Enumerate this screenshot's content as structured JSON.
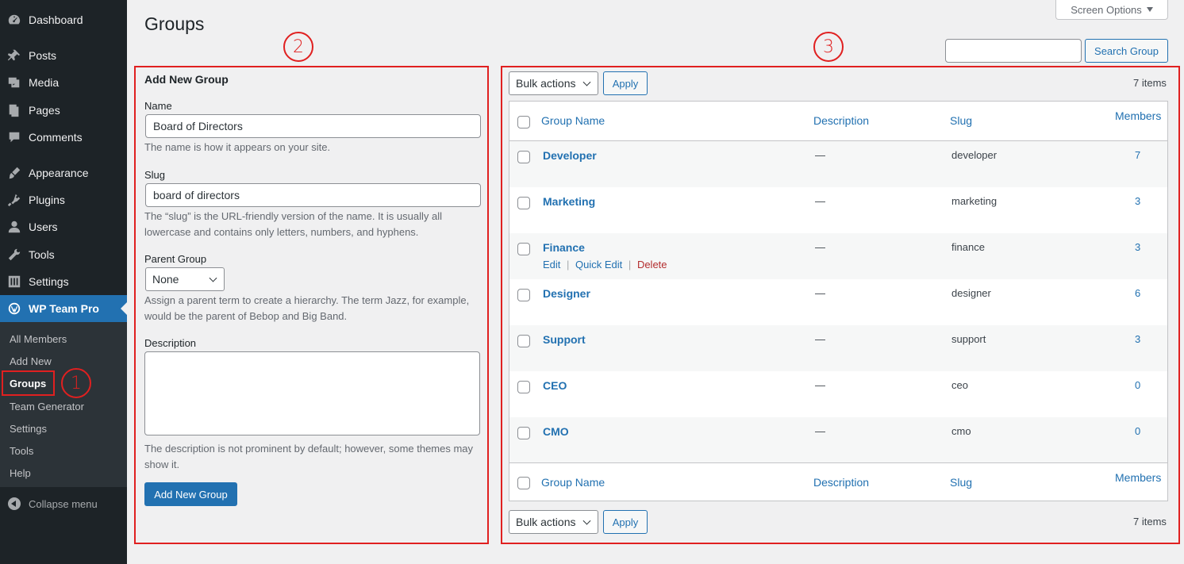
{
  "sidebar": {
    "items": [
      {
        "label": "Dashboard",
        "icon": "dashboard-icon"
      },
      {
        "label": "Posts",
        "icon": "pin-icon"
      },
      {
        "label": "Media",
        "icon": "media-icon"
      },
      {
        "label": "Pages",
        "icon": "page-icon"
      },
      {
        "label": "Comments",
        "icon": "comment-icon"
      },
      {
        "label": "Appearance",
        "icon": "brush-icon"
      },
      {
        "label": "Plugins",
        "icon": "plug-icon"
      },
      {
        "label": "Users",
        "icon": "user-icon"
      },
      {
        "label": "Tools",
        "icon": "wrench-icon"
      },
      {
        "label": "Settings",
        "icon": "sliders-icon"
      },
      {
        "label": "WP Team Pro",
        "icon": "wordpress-icon"
      }
    ],
    "submenu": [
      "All Members",
      "Add New",
      "Groups",
      "Team Generator",
      "Settings",
      "Tools",
      "Help"
    ],
    "collapse_label": "Collapse menu"
  },
  "header": {
    "title": "Groups",
    "screen_options": "Screen Options",
    "search_button": "Search Group",
    "search_value": ""
  },
  "annotations": [
    "1",
    "2",
    "3"
  ],
  "form": {
    "heading": "Add New Group",
    "name_label": "Name",
    "name_value": "Board of Directors",
    "name_help": "The name is how it appears on your site.",
    "slug_label": "Slug",
    "slug_value": "board of directors",
    "slug_help": "The “slug” is the URL-friendly version of the name. It is usually all lowercase and contains only letters, numbers, and hyphens.",
    "parent_label": "Parent Group",
    "parent_value": "None",
    "parent_help": "Assign a parent term to create a hierarchy. The term Jazz, for example, would be the parent of Bebop and Big Band.",
    "description_label": "Description",
    "description_value": "",
    "description_help": "The description is not prominent by default; however, some themes may show it.",
    "submit": "Add New Group"
  },
  "table": {
    "bulk_actions": "Bulk actions",
    "apply": "Apply",
    "items_count": "7 items",
    "columns": [
      "Group Name",
      "Description",
      "Slug",
      "Members"
    ],
    "rows": [
      {
        "name": "Developer",
        "description": "—",
        "slug": "developer",
        "count": "7"
      },
      {
        "name": "Marketing",
        "description": "—",
        "slug": "marketing",
        "count": "3"
      },
      {
        "name": "Finance",
        "description": "—",
        "slug": "finance",
        "count": "3"
      },
      {
        "name": "Designer",
        "description": "—",
        "slug": "designer",
        "count": "6"
      },
      {
        "name": "Support",
        "description": "—",
        "slug": "support",
        "count": "3"
      },
      {
        "name": "CEO",
        "description": "—",
        "slug": "ceo",
        "count": "0"
      },
      {
        "name": "CMO",
        "description": "—",
        "slug": "cmo",
        "count": "0"
      }
    ],
    "row_actions": {
      "edit": "Edit",
      "quick_edit": "Quick Edit",
      "delete": "Delete",
      "separator": "|"
    }
  },
  "colors": {
    "accent": "#2271b1",
    "sidebar": "#1d2327",
    "annotation": "#e02020",
    "delete": "#b32d2e"
  }
}
